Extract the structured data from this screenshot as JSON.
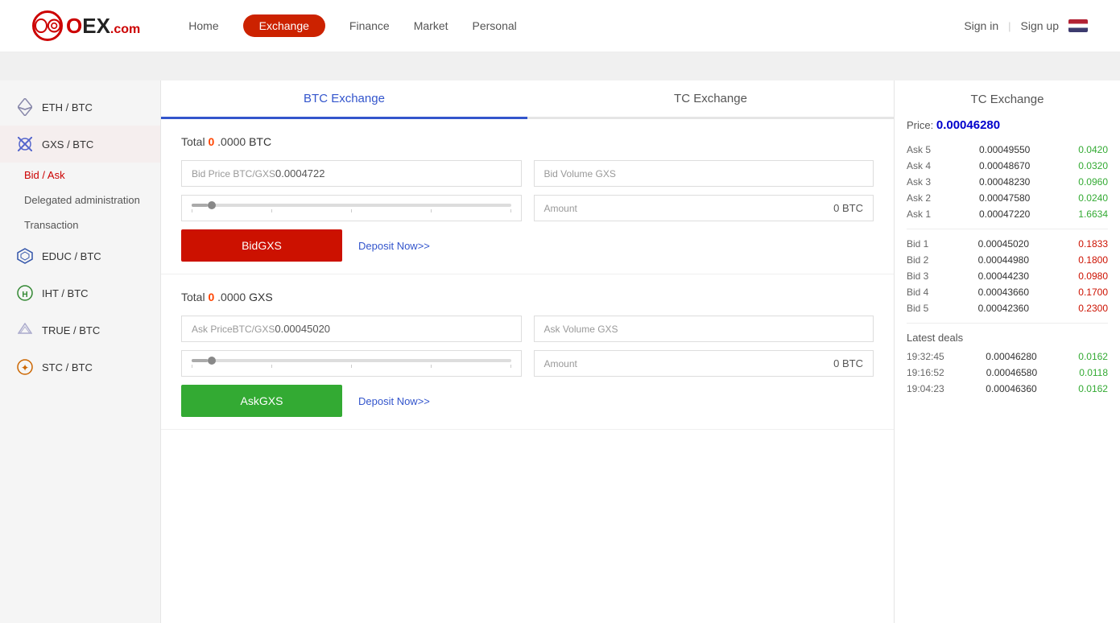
{
  "header": {
    "logo_text": "OEX",
    "logo_com": ".com",
    "nav": [
      {
        "label": "Home",
        "active": false
      },
      {
        "label": "Exchange",
        "active": true
      },
      {
        "label": "Finance",
        "active": false
      },
      {
        "label": "Market",
        "active": false
      },
      {
        "label": "Personal",
        "active": false
      }
    ],
    "sign_in": "Sign in",
    "sign_up": "Sign up"
  },
  "sidebar": {
    "items": [
      {
        "id": "eth-btc",
        "label": "ETH / BTC",
        "icon": "◈",
        "active": false
      },
      {
        "id": "gxs-btc",
        "label": "GXS / BTC",
        "icon": "✕",
        "active": true
      },
      {
        "id": "educ-btc",
        "label": "EDUC / BTC",
        "icon": "⬡",
        "active": false
      },
      {
        "id": "iht-btc",
        "label": "IHT / BTC",
        "icon": "⊙",
        "active": false
      },
      {
        "id": "true-btc",
        "label": "TRUE / BTC",
        "icon": "◇",
        "active": false
      },
      {
        "id": "stc-btc",
        "label": "STC / BTC",
        "icon": "❋",
        "active": false
      }
    ],
    "sub_items": [
      {
        "label": "Bid / Ask",
        "active": true
      },
      {
        "label": "Delegated administration",
        "active": false
      },
      {
        "label": "Transaction",
        "active": false
      }
    ]
  },
  "exchange": {
    "tab_active": "BTC Exchange",
    "tab_inactive": "TC Exchange",
    "bid_section": {
      "total_label": "Total",
      "total_zero": "0",
      "total_decimal": ".0000",
      "total_currency": "BTC",
      "bid_price_label": "Bid Price BTC/GXS",
      "bid_price_value": "0.0004722",
      "bid_volume_label": "Bid Volume GXS",
      "amount_label": "Amount",
      "amount_value": "0 BTC",
      "bid_button": "BidGXS",
      "deposit_link": "Deposit Now>>"
    },
    "ask_section": {
      "total_label": "Total",
      "total_zero": "0",
      "total_decimal": ".0000",
      "total_currency": "GXS",
      "ask_price_label": "Ask PriceBTC/GXS",
      "ask_price_value": "0.00045020",
      "ask_volume_label": "Ask Volume GXS",
      "amount_label": "Amount",
      "amount_value": "0 BTC",
      "ask_button": "AskGXS",
      "deposit_link": "Deposit Now>>"
    }
  },
  "order_book": {
    "title": "TC Exchange",
    "price_label": "Price:",
    "price_value": "0.00046280",
    "asks": [
      {
        "label": "Ask 5",
        "price": "0.00049550",
        "vol": "0.0420",
        "side": "green"
      },
      {
        "label": "Ask 4",
        "price": "0.00048670",
        "vol": "0.0320",
        "side": "green"
      },
      {
        "label": "Ask 3",
        "price": "0.00048230",
        "vol": "0.0960",
        "side": "green"
      },
      {
        "label": "Ask 2",
        "price": "0.00047580",
        "vol": "0.0240",
        "side": "green"
      },
      {
        "label": "Ask 1",
        "price": "0.00047220",
        "vol": "1.6634",
        "side": "green"
      }
    ],
    "bids": [
      {
        "label": "Bid 1",
        "price": "0.00045020",
        "vol": "0.1833",
        "side": "red"
      },
      {
        "label": "Bid 2",
        "price": "0.00044980",
        "vol": "0.1800",
        "side": "red"
      },
      {
        "label": "Bid 3",
        "price": "0.00044230",
        "vol": "0.0980",
        "side": "red"
      },
      {
        "label": "Bid 4",
        "price": "0.00043660",
        "vol": "0.1700",
        "side": "red"
      },
      {
        "label": "Bid 5",
        "price": "0.00042360",
        "vol": "0.2300",
        "side": "red"
      }
    ],
    "latest_deals_title": "Latest deals",
    "deals": [
      {
        "time": "19:32:45",
        "price": "0.00046280",
        "vol": "0.0162",
        "side": "green"
      },
      {
        "time": "19:16:52",
        "price": "0.00046580",
        "vol": "0.0118",
        "side": "green"
      },
      {
        "time": "19:04:23",
        "price": "0.00046360",
        "vol": "0.0162",
        "side": "green"
      }
    ]
  }
}
